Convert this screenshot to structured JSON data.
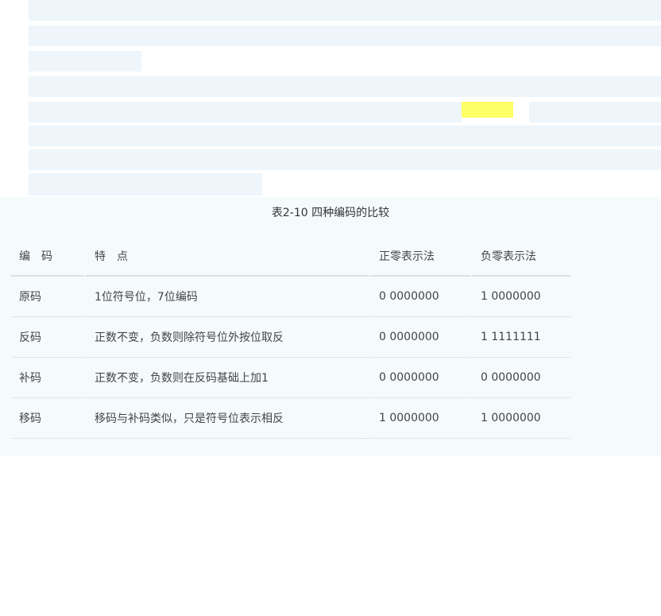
{
  "table": {
    "caption": "表2-10 四种编码的比较",
    "headers": {
      "code": "编　码",
      "feature": "特　点",
      "positive_zero": "正零表示法",
      "negative_zero": "负零表示法"
    },
    "rows": [
      {
        "code": "原码",
        "feature": "1位符号位，7位编码",
        "positive_zero": "0 0000000",
        "negative_zero": "1 0000000"
      },
      {
        "code": "反码",
        "feature": "正数不变，负数则除符号位外按位取反",
        "positive_zero": "0 0000000",
        "negative_zero": "1 1111111"
      },
      {
        "code": "补码",
        "feature": "正数不变，负数则在反码基础上加1",
        "positive_zero": "0 0000000",
        "negative_zero": "0 0000000"
      },
      {
        "code": "移码",
        "feature": "移码与补码类似，只是符号位表示相反",
        "positive_zero": "1 0000000",
        "negative_zero": "1 0000000"
      }
    ]
  },
  "colors": {
    "panel_background": "#f5fafd",
    "redaction": "#eef6fb",
    "highlight": "#ffff66"
  }
}
